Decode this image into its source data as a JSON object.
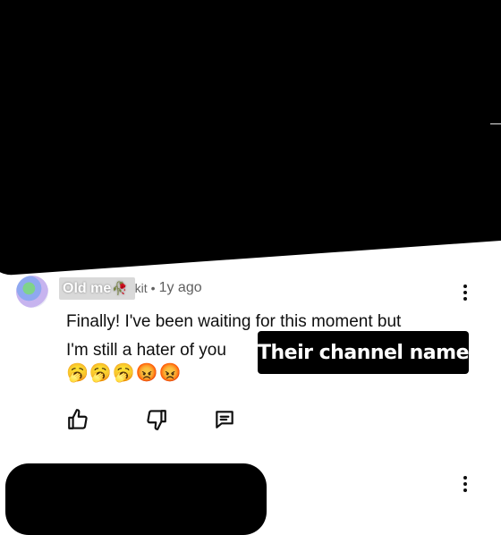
{
  "overlay": {
    "label": "Their channel name"
  },
  "comment": {
    "author_sticker": "Old me",
    "author_tail": "kit",
    "separator": "•",
    "age": "1y ago",
    "text_line1": "Finally! I've been waiting for this moment but",
    "text_line2": "I'm still a hater of you",
    "emojis": "🥱🥱🥱😡😡"
  },
  "icons": {
    "avatar": "avatar",
    "rose": "🥀",
    "menu": "kebab-icon",
    "like": "thumb-up-icon",
    "dislike": "thumb-down-icon",
    "reply": "reply-icon"
  }
}
